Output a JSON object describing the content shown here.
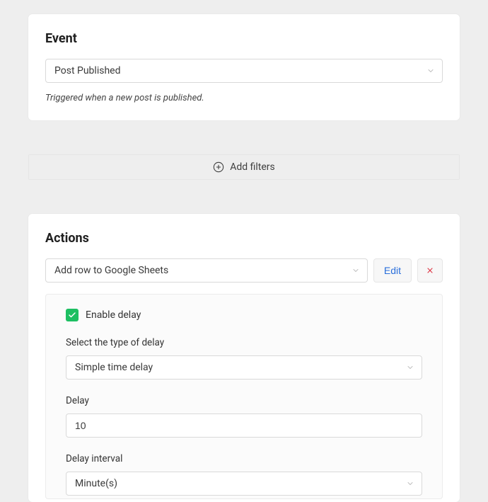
{
  "event": {
    "title": "Event",
    "select_value": "Post Published",
    "helper": "Triggered when a new post is published."
  },
  "filters": {
    "add_label": "Add filters"
  },
  "actions": {
    "title": "Actions",
    "select_value": "Add row to Google Sheets",
    "edit_label": "Edit",
    "delay": {
      "enable_label": "Enable delay",
      "type_label": "Select the type of delay",
      "type_value": "Simple time delay",
      "amount_label": "Delay",
      "amount_value": "10",
      "interval_label": "Delay interval",
      "interval_value": "Minute(s)"
    }
  }
}
